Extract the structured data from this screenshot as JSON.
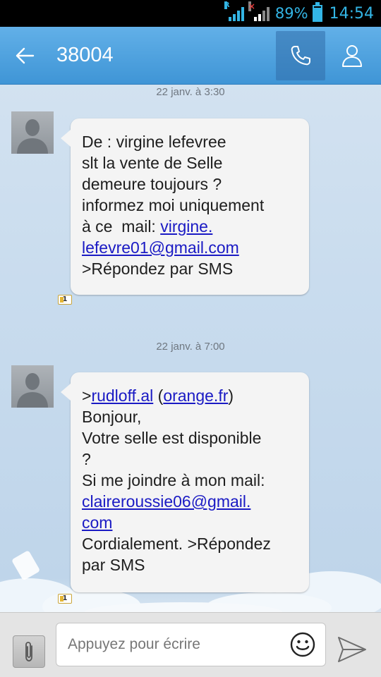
{
  "status_bar": {
    "battery_percent": "89%",
    "battery_level": 0.89,
    "time": "14:54",
    "signal_icons": [
      "signal-roaming-icon",
      "signal-noservice-icon",
      "battery-icon"
    ]
  },
  "action_bar": {
    "title": "38004",
    "back_icon": "back-arrow-icon",
    "call_icon": "phone-icon",
    "contact_icon": "person-icon"
  },
  "messages": [
    {
      "timestamp": "22 janv. à 3:30",
      "lines": [
        {
          "text": "De : virgine lefevree"
        },
        {
          "text": "slt la vente de Selle"
        },
        {
          "text": "demeure toujours ?"
        },
        {
          "text": "informez moi uniquement"
        },
        {
          "prefix": "à ce  mail: ",
          "link": "virgine."
        },
        {
          "link": "lefevre01@gmail.com"
        },
        {
          "text": ">Répondez par SMS"
        }
      ],
      "sim_badge": "1"
    },
    {
      "timestamp": "22 janv. à 7:00",
      "lines": [
        {
          "prefix": ">",
          "link": "rudloff.al",
          "mid": " (",
          "link2": "orange.fr",
          "suffix": ")"
        },
        {
          "text": "Bonjour,"
        },
        {
          "text": "Votre selle est disponible"
        },
        {
          "text": "?"
        },
        {
          "text": "Si me joindre à mon mail:"
        },
        {
          "link": "claireroussie06@gmail."
        },
        {
          "link": "com"
        },
        {
          "text": "Cordialement. >Répondez"
        },
        {
          "text": "par SMS"
        }
      ],
      "sim_badge": "1"
    }
  ],
  "composer": {
    "placeholder": "Appuyez pour écrire",
    "attach_icon": "paperclip-icon",
    "emoji_icon": "smiley-icon",
    "send_icon": "send-icon"
  }
}
